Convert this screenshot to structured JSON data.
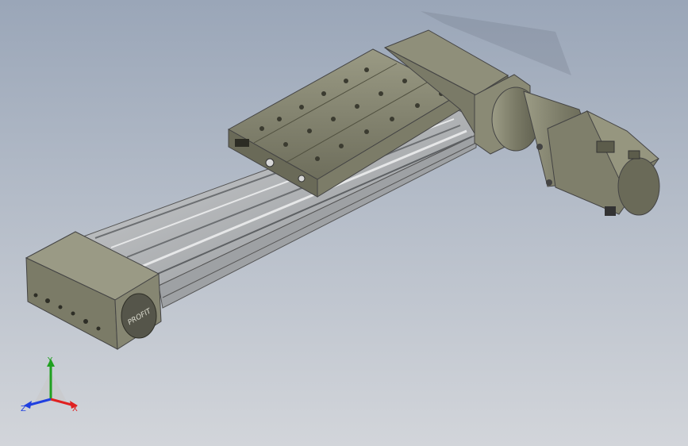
{
  "viewport": {
    "background_top": "#9aa6b8",
    "background_bottom": "#d2d5da"
  },
  "model": {
    "brand_text": "PROFIT",
    "body_color": "#8a8a74",
    "rail_color": "#b9bcbf"
  },
  "triad": {
    "x_label": "X",
    "y_label": "Y",
    "z_label": "Z",
    "x_color": "#e02020",
    "y_color": "#20a020",
    "z_color": "#2040e0"
  }
}
